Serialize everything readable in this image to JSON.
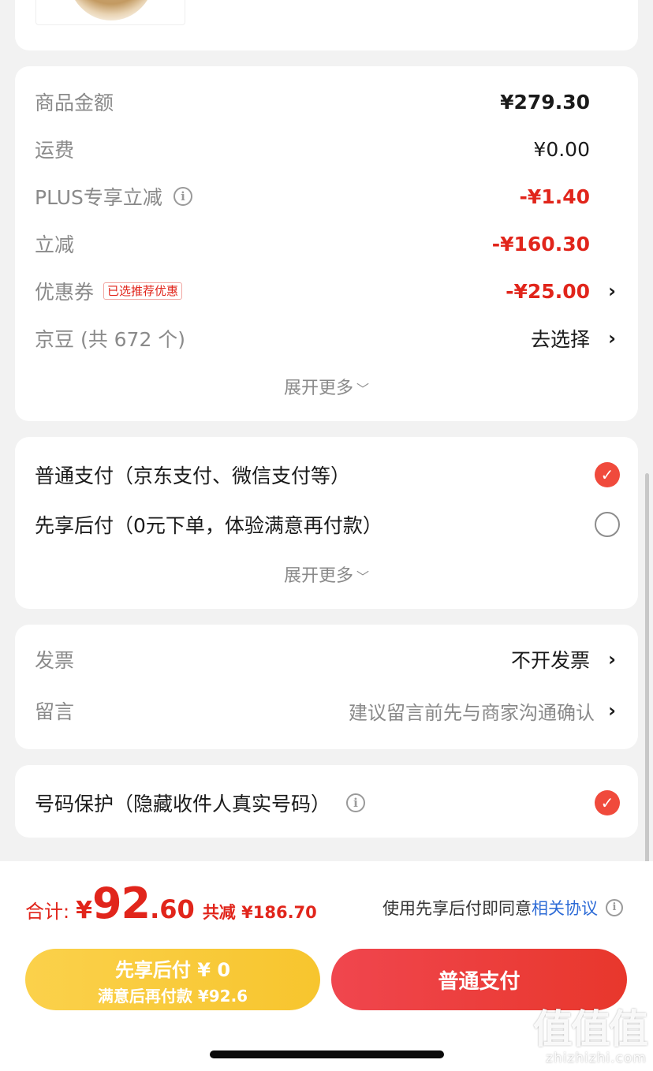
{
  "summary": {
    "rows": [
      {
        "label": "商品金额",
        "value": "¥279.30"
      },
      {
        "label": "运费",
        "value": "¥0.00"
      },
      {
        "label": "PLUS专享立减",
        "value": "-¥1.40"
      },
      {
        "label": "立减",
        "value": "-¥160.30"
      },
      {
        "label": "优惠券",
        "tag": "已选推荐优惠",
        "value": "-¥25.00"
      },
      {
        "label": "京豆 (共 672 个)",
        "value": "去选择"
      }
    ],
    "expand_label": "展开更多"
  },
  "payment": {
    "options": [
      {
        "label": "普通支付（京东支付、微信支付等）",
        "selected": true
      },
      {
        "label": "先享后付（0元下单，体验满意再付款）",
        "selected": false
      }
    ],
    "expand_label": "展开更多"
  },
  "extras": {
    "invoice": {
      "label": "发票",
      "value": "不开发票"
    },
    "message": {
      "label": "留言",
      "value": "建议留言前先与商家沟通确认"
    }
  },
  "privacy": {
    "label": "号码保护（隐藏收件人真实号码）",
    "checked": true
  },
  "footer": {
    "total_label": "合计:",
    "currency": "¥",
    "total_int": "92",
    "total_dec": ".60",
    "savings": "共减 ¥186.70",
    "agree_prefix": "使用先享后付即同意",
    "agree_link": "相关协议",
    "later_line1": "先享后付 ¥ 0",
    "later_line2": "满意后再付款 ¥92.6",
    "pay_label": "普通支付"
  },
  "watermark": {
    "logo": "值值值",
    "site": "zhizhizhi.com"
  },
  "icons": {
    "info": "info-icon",
    "chevron": "chevron-right-icon",
    "check": "check-icon",
    "caret": "chevron-down-icon"
  },
  "colors": {
    "accent_red": "#e1251b",
    "later_yellow": "#f7c52e",
    "link_blue": "#2d6bd6"
  }
}
